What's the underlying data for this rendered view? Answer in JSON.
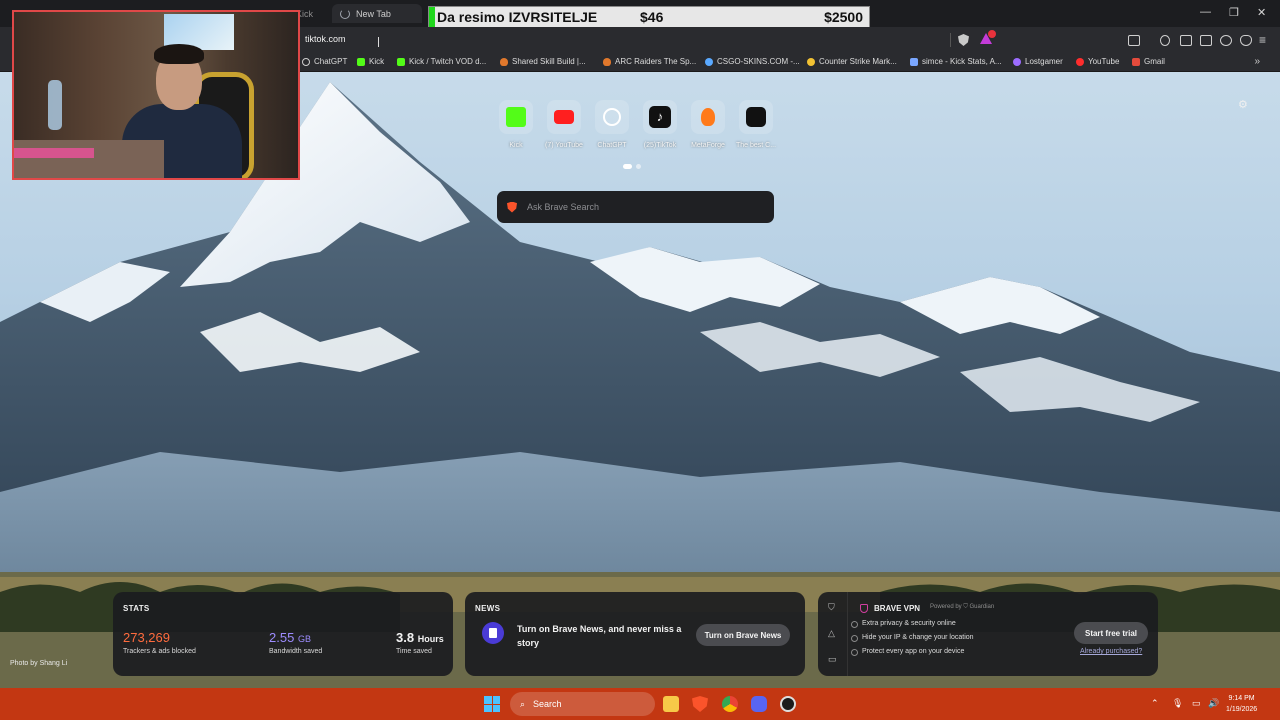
{
  "browser": {
    "tabs": [
      {
        "label": "New Tab",
        "active": true,
        "loading": true
      }
    ],
    "background_tabs_text": "Kick",
    "address": "tiktok.com",
    "window_controls": {
      "minimize": "—",
      "restore": "❐",
      "close": "✕"
    },
    "bookmarks": [
      {
        "label": "ChatGPT",
        "icon": "chatgpt-icon",
        "color": "#cfcfcf"
      },
      {
        "label": "Kick",
        "icon": "kick-icon",
        "color": "#53fc18"
      },
      {
        "label": "Kick / Twitch VOD d...",
        "icon": "kick-d-icon",
        "color": "#53fc18"
      },
      {
        "label": "Shared Skill Build |...",
        "icon": "flame-icon",
        "color": "#e0782c"
      },
      {
        "label": "ARC Raiders The Sp...",
        "icon": "flame-icon",
        "color": "#e0782c"
      },
      {
        "label": "CSGO-SKINS.COM -...",
        "icon": "globe-icon",
        "color": "#5aa9ff"
      },
      {
        "label": "Counter Strike Mark...",
        "icon": "cs-icon",
        "color": "#f2c233"
      },
      {
        "label": "simce - Kick Stats, A...",
        "icon": "stats-icon",
        "color": "#7aa7ff"
      },
      {
        "label": "Lostgamer",
        "icon": "g-icon",
        "color": "#9c6cff"
      },
      {
        "label": "YouTube",
        "icon": "youtube-icon",
        "color": "#ff2d2d"
      },
      {
        "label": "Gmail",
        "icon": "gmail-icon",
        "color": "#e44b3c"
      }
    ],
    "bookmarks_more": "»"
  },
  "overlay": {
    "title": "Da resimo IZVRSITELJE",
    "current": "$46",
    "goal": "$2500",
    "accent": "#1fd61c"
  },
  "ntp": {
    "top_sites": [
      {
        "label": "Kick",
        "icon": "kick-icon",
        "color": "#53fc18"
      },
      {
        "label": "(7) YouTube",
        "icon": "youtube-icon",
        "color": "#ff1f1f"
      },
      {
        "label": "ChatGPT",
        "icon": "chatgpt-icon",
        "color": "#ffffff"
      },
      {
        "label": "(25)TikTok",
        "icon": "tiktok-icon",
        "color": "#111111"
      },
      {
        "label": "MetaForge",
        "icon": "metaforge-icon",
        "color": "#ff7a1a"
      },
      {
        "label": "The best C...",
        "icon": "cs-case-icon",
        "color": "#111111"
      }
    ],
    "search_placeholder": "Ask Brave Search",
    "photo_credit": "Photo by Shang Li",
    "stats": {
      "title": "STATS",
      "trackers": {
        "value": "273,269",
        "label": "Trackers & ads blocked",
        "color": "#ff6b3d"
      },
      "bandwidth": {
        "value": "2.55",
        "unit": "GB",
        "label": "Bandwidth saved",
        "color": "#9d8cff"
      },
      "time": {
        "value": "3.8",
        "unit": "Hours",
        "label": "Time saved"
      }
    },
    "news": {
      "title": "NEWS",
      "text": "Turn on Brave News, and never miss a story",
      "button": "Turn on Brave News"
    },
    "vpn": {
      "title": "BRAVE VPN",
      "powered_by": "Powered by ⛉ Guardian",
      "features": [
        "Extra privacy & security online",
        "Hide your IP & change your location",
        "Protect every app on your device"
      ],
      "cta": "Start free trial",
      "already": "Already purchased?"
    }
  },
  "taskbar": {
    "search_label": "Search",
    "time": "9:14 PM",
    "date": "1/19/2026"
  }
}
